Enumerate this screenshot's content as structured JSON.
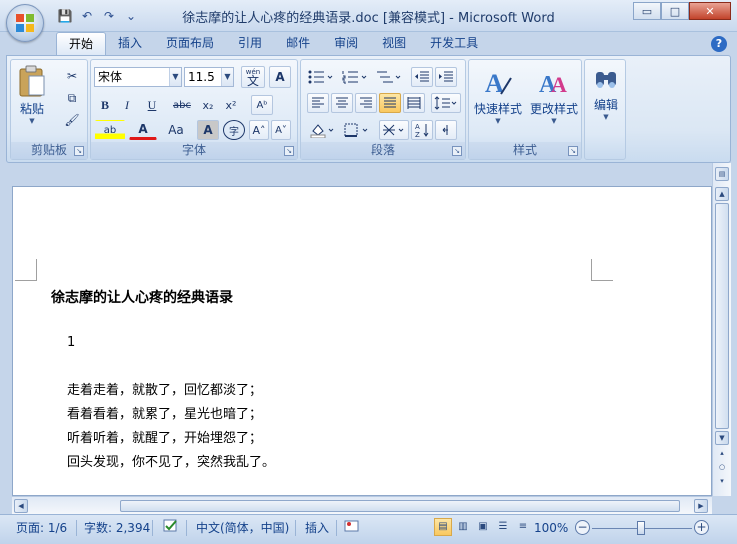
{
  "window": {
    "title": "徐志摩的让人心疼的经典语录.doc [兼容模式] - Microsoft Word",
    "minimize_icon": "▭",
    "maximize_icon": "□",
    "close_icon": "✕"
  },
  "qat": {
    "save_icon": "💾",
    "undo_icon": "↶",
    "redo_icon": "↷",
    "more_icon": "⌄"
  },
  "tabs": [
    "开始",
    "插入",
    "页面布局",
    "引用",
    "邮件",
    "审阅",
    "视图",
    "开发工具"
  ],
  "ribbon": {
    "clipboard": {
      "label": "剪贴板",
      "paste": "粘贴",
      "cut_icon": "✂",
      "copy_icon": "⧉",
      "painter_icon": "🖌"
    },
    "font": {
      "label": "字体",
      "font_name": "宋体",
      "font_size": "11.5",
      "wen": "wén",
      "wen_char": "文",
      "border_char": "A",
      "bold": "B",
      "italic": "I",
      "underline": "U",
      "strike": "abc",
      "sub": "x₂",
      "sup": "x²",
      "clear": "Aᵇ",
      "highlight": "ab",
      "fontcolor": "A",
      "case": "Aa",
      "shade": "A",
      "circle": "字",
      "grow": "A˄",
      "shrink": "A˅"
    },
    "paragraph": {
      "label": "段落"
    },
    "styles": {
      "label": "样式",
      "quick": "快速样式",
      "change": "更改样式"
    },
    "editing": {
      "label": "编辑"
    }
  },
  "document": {
    "title": "徐志摩的让人心疼的经典语录",
    "number": "1",
    "lines": [
      "走着走着，就散了，回忆都淡了；",
      "看着看着，就累了，星光也暗了；",
      "听着听着，就醒了，开始埋怨了；",
      "回头发现，你不见了，突然我乱了。"
    ]
  },
  "status": {
    "page": "页面: 1/6",
    "words": "字数: 2,394",
    "lang": "中文(简体，中国)",
    "mode": "插入",
    "zoom": "100%",
    "zoom_minus": "−",
    "zoom_plus": "+"
  }
}
